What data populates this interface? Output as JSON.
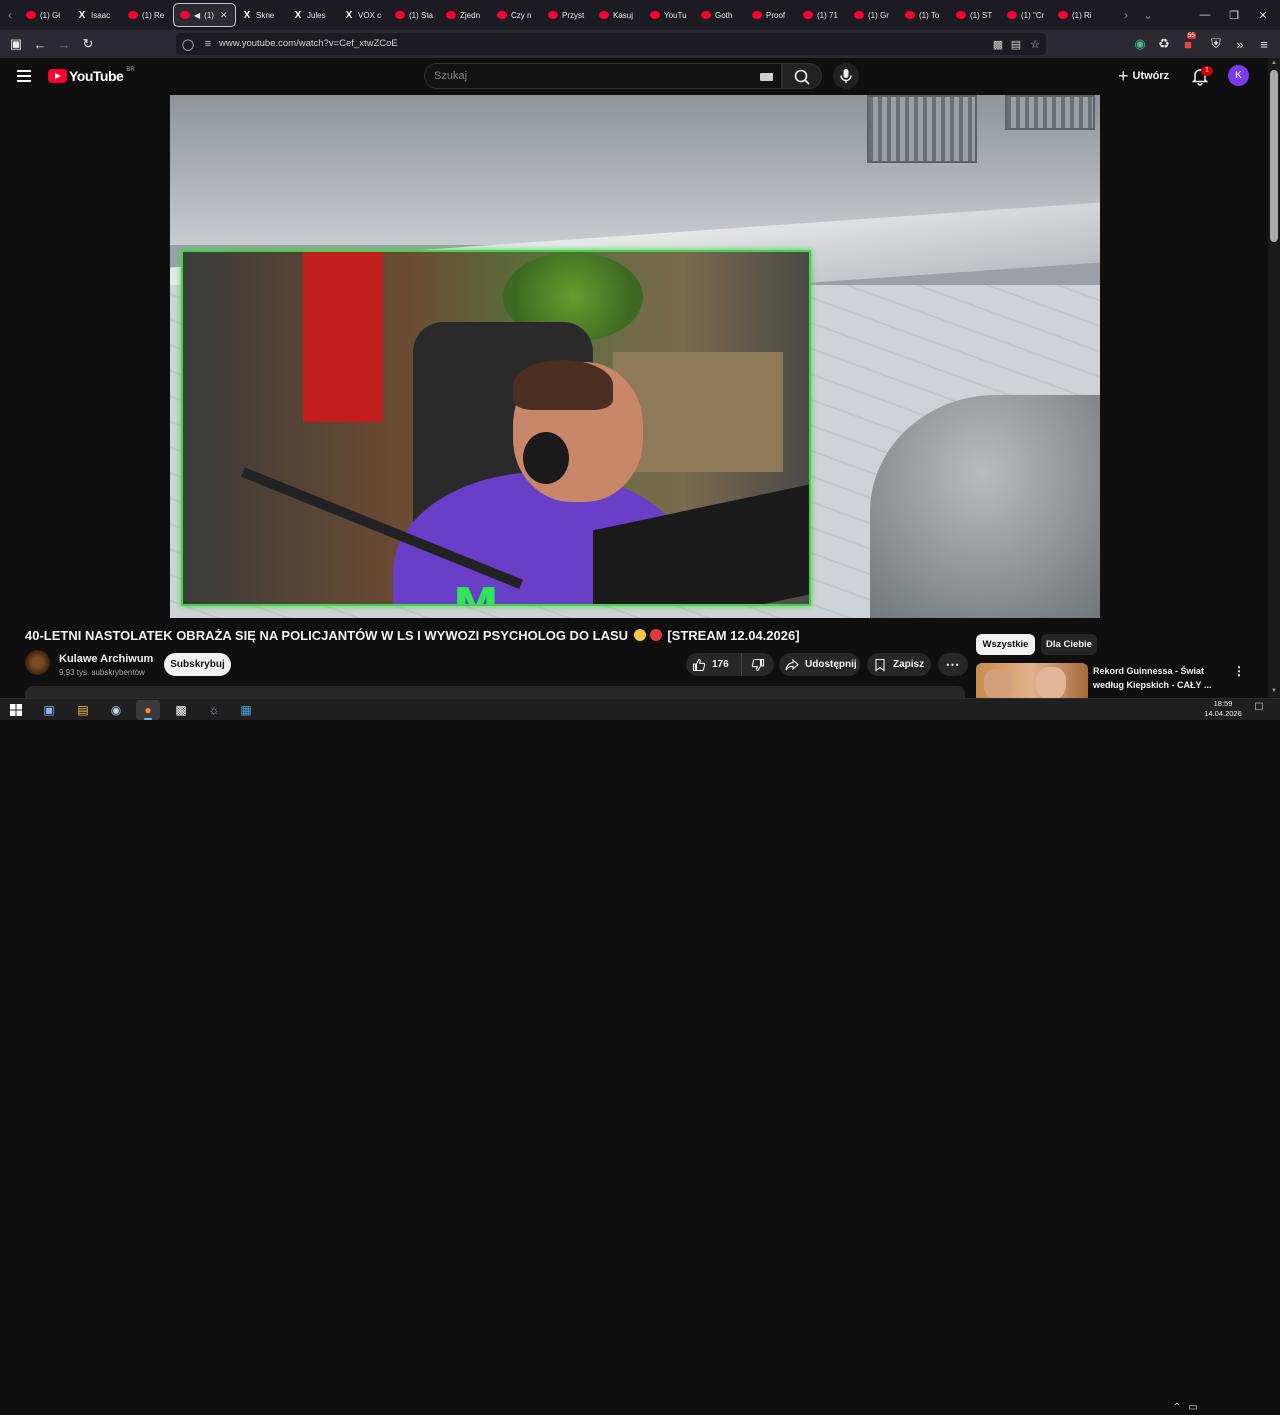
{
  "browser": {
    "tabs": [
      {
        "icon": "youtube-icon",
        "label": "(1) Gł"
      },
      {
        "icon": "x-icon",
        "label": "Isaac"
      },
      {
        "icon": "youtube-icon",
        "label": "(1) Re"
      },
      {
        "icon": "youtube-icon",
        "label": "(1)",
        "active": true
      },
      {
        "icon": "x-icon",
        "label": "Skne"
      },
      {
        "icon": "x-icon",
        "label": "Jules"
      },
      {
        "icon": "x-icon",
        "label": "VOX c"
      },
      {
        "icon": "youtube-icon",
        "label": "(1) Sta"
      },
      {
        "icon": "youtube-icon",
        "label": "Zjedn"
      },
      {
        "icon": "youtube-icon",
        "label": "Czy n"
      },
      {
        "icon": "youtube-icon",
        "label": "Przyst"
      },
      {
        "icon": "youtube-icon",
        "label": "Kasuj"
      },
      {
        "icon": "youtube-icon",
        "label": "YouTu"
      },
      {
        "icon": "youtube-icon",
        "label": "Goth"
      },
      {
        "icon": "youtube-icon",
        "label": "Proof"
      },
      {
        "icon": "youtube-icon",
        "label": "(1) 71"
      },
      {
        "icon": "youtube-icon",
        "label": "(1) Gr"
      },
      {
        "icon": "youtube-icon",
        "label": "(1) To"
      },
      {
        "icon": "youtube-icon",
        "label": "(1) ST"
      },
      {
        "icon": "youtube-icon",
        "label": "(1) \"Cr"
      },
      {
        "icon": "youtube-icon",
        "label": "(1) Ri"
      }
    ],
    "url": "www.youtube.com/watch?v=Cef_xtwZCoE",
    "extension_badge": "55"
  },
  "youtube": {
    "logo_text": "YouTube",
    "country_code": "BR",
    "search_placeholder": "Szukaj",
    "create_label": "Utwórz",
    "notification_count": "1",
    "avatar_letter": "K"
  },
  "video": {
    "title_prefix": "40-LETNI NASTOLATEK OBRAŻA SIĘ NA POLICJANTÓW W LS I WYWOZI PSYCHOLOG DO LASU",
    "title_suffix": "[STREAM 12.04.2026]",
    "overlay_logo": "M",
    "channel_name": "Kulawe Archiwum",
    "channel_subs": "9,93 tys. subskrybentów",
    "subscribe_label": "Subskrybuj",
    "likes": "176",
    "share_label": "Udostępnij",
    "save_label": "Zapisz"
  },
  "sidebar": {
    "chips": [
      "Wszystkie",
      "Dla Ciebie"
    ],
    "recommended_title": "Rekord Guinnessa - Świat według Kiepskich - CAŁY ..."
  },
  "taskbar": {
    "time": "18:59",
    "date": "14.04.2026"
  },
  "colors": {
    "youtube_red": "#ff0033",
    "webcam_border": "#46d34c",
    "avatar_bg": "#7c3aed"
  }
}
